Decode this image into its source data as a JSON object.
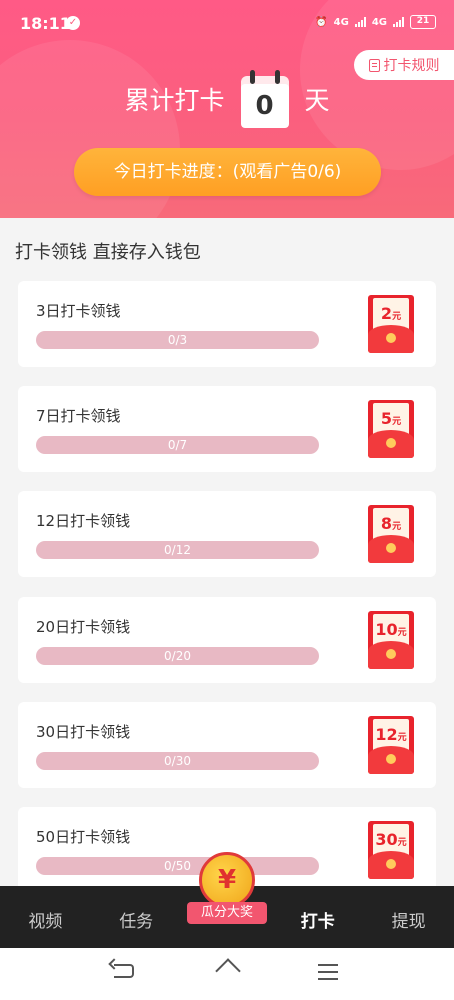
{
  "status_bar": {
    "time": "18:11",
    "network": "4G",
    "battery": "21"
  },
  "header": {
    "rule_button": "打卡规则",
    "title_prefix": "累计打卡",
    "days": "0",
    "title_suffix": "天",
    "progress_text": "今日打卡进度：(观看广告0/6)"
  },
  "section_title": "打卡领钱 直接存入钱包",
  "cards": [
    {
      "label": "3日打卡领钱",
      "progress": "0/3",
      "progress_fraction": 0,
      "amount": "2",
      "unit": "元"
    },
    {
      "label": "7日打卡领钱",
      "progress": "0/7",
      "progress_fraction": 0,
      "amount": "5",
      "unit": "元"
    },
    {
      "label": "12日打卡领钱",
      "progress": "0/12",
      "progress_fraction": 0,
      "amount": "8",
      "unit": "元"
    },
    {
      "label": "20日打卡领钱",
      "progress": "0/20",
      "progress_fraction": 0,
      "amount": "10",
      "unit": "元"
    },
    {
      "label": "30日打卡领钱",
      "progress": "0/30",
      "progress_fraction": 0,
      "amount": "12",
      "unit": "元"
    },
    {
      "label": "50日打卡领钱",
      "progress": "0/50",
      "progress_fraction": 0,
      "amount": "30",
      "unit": "元"
    }
  ],
  "bottom_nav": {
    "items": [
      "视频",
      "任务",
      "",
      "打卡",
      "提现"
    ],
    "center_symbol": "¥",
    "center_label": "瓜分大奖",
    "active_index": 3
  }
}
